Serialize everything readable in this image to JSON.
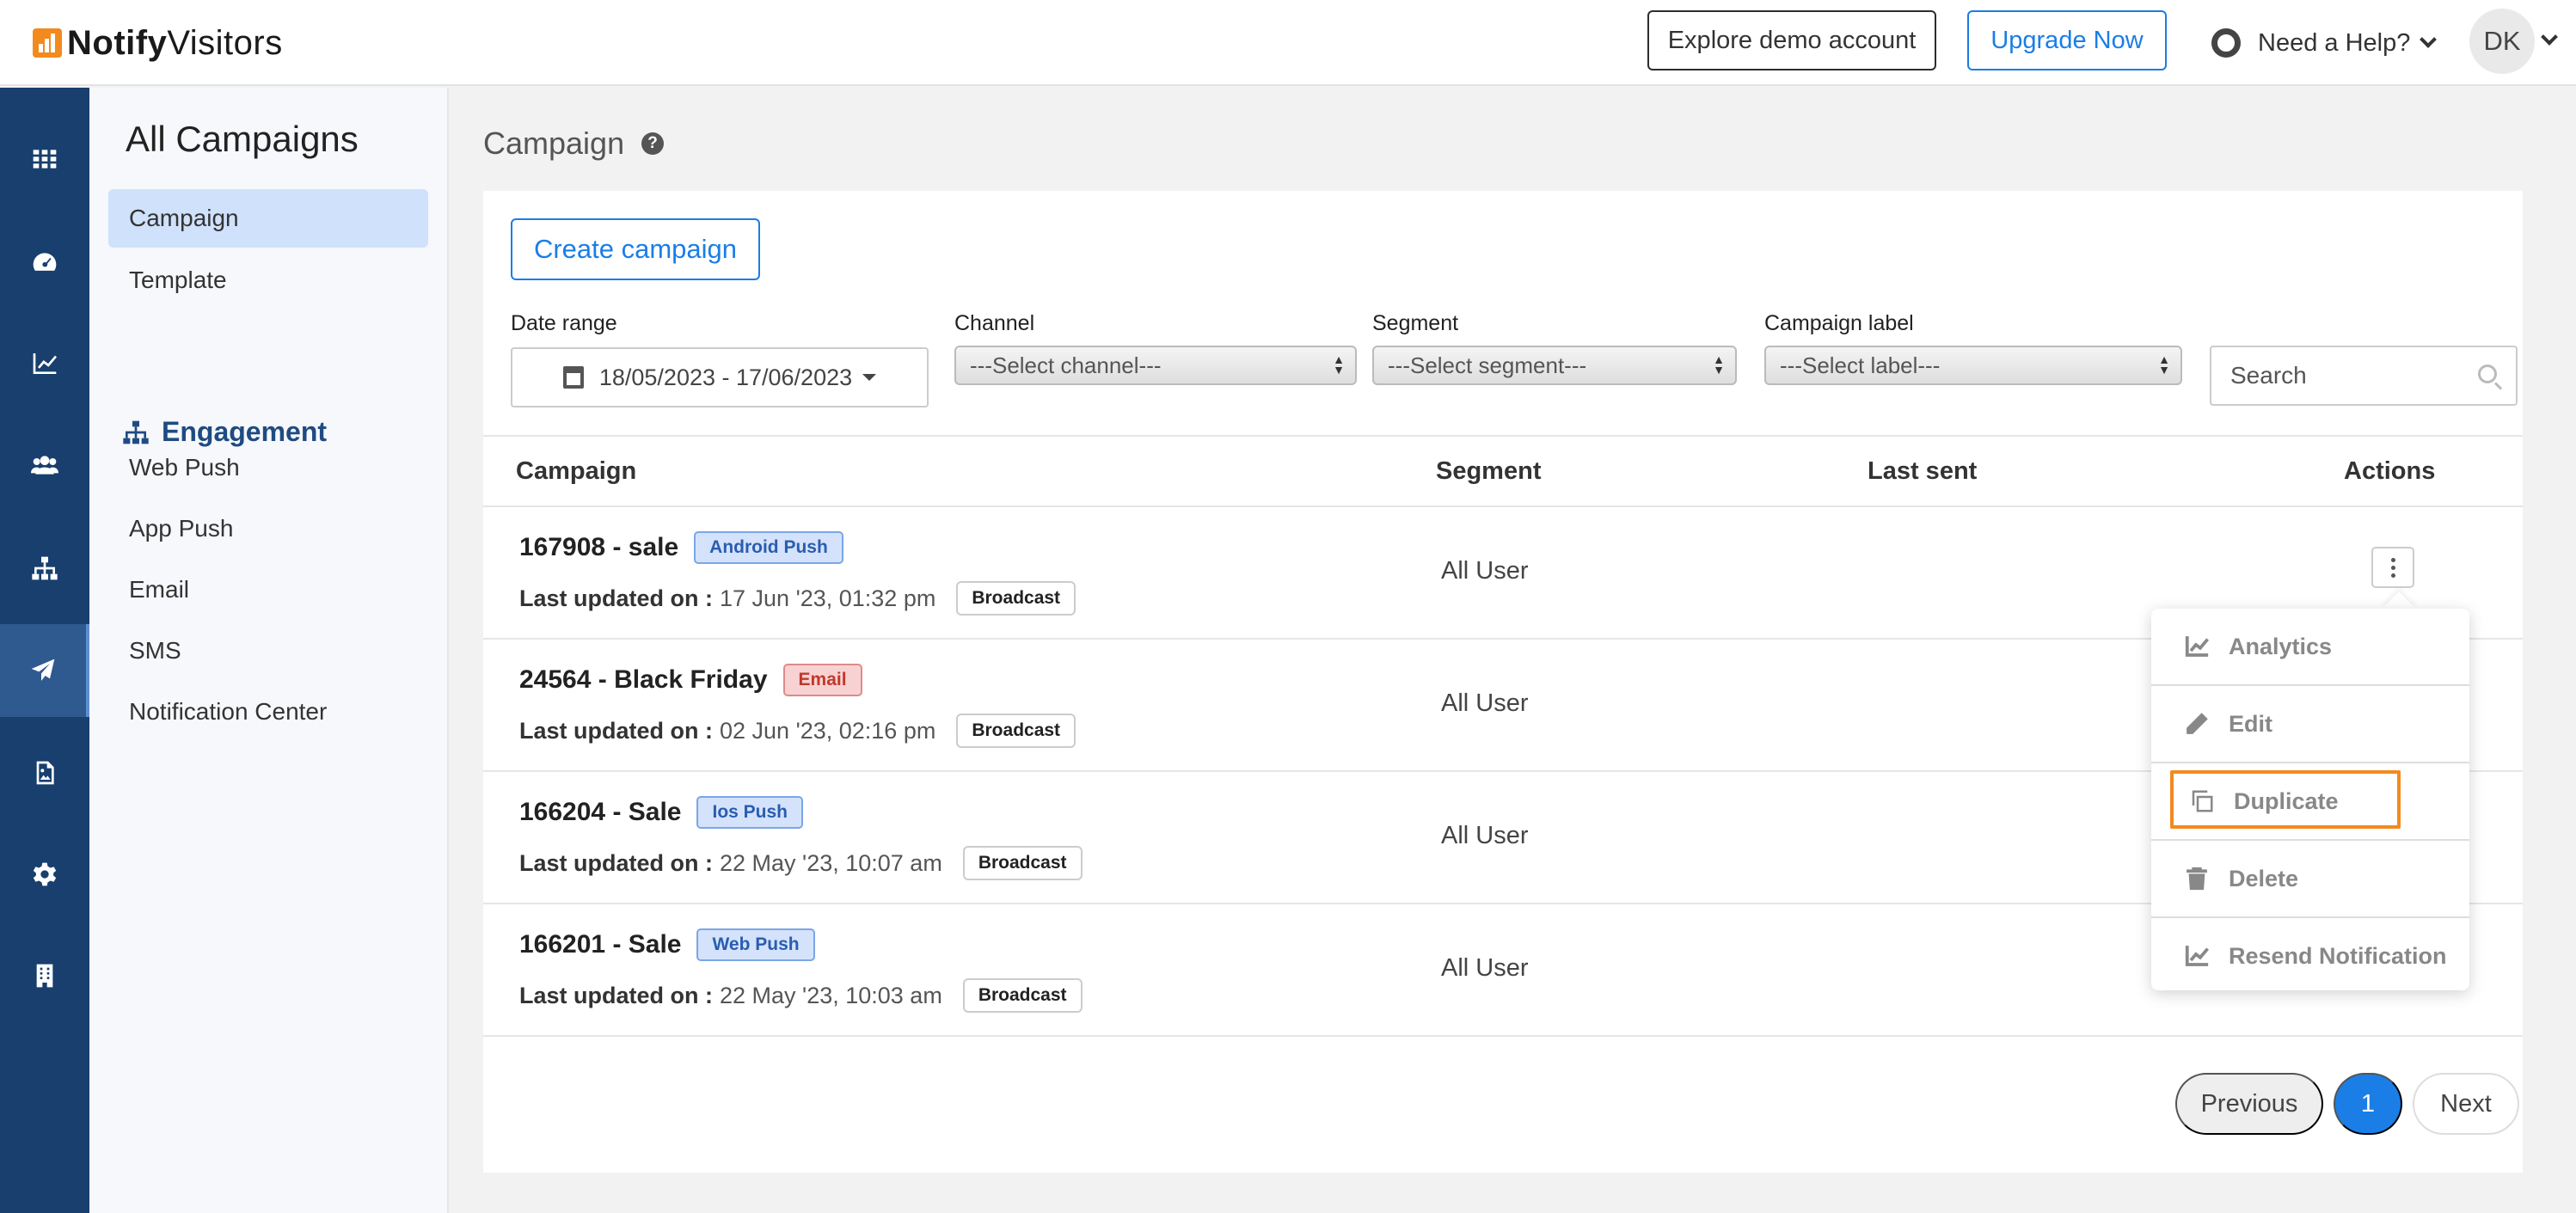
{
  "brand": {
    "name_bold": "Notify",
    "name_regular": "Visitors",
    "accent_color": "#f28a1e"
  },
  "topbar": {
    "demo_label": "Explore demo account",
    "upgrade_label": "Upgrade Now",
    "help_label": "Need a Help?",
    "avatar_initials": "DK"
  },
  "rail": {
    "icons": [
      "grid-icon",
      "dashboard-gauge-icon",
      "line-chart-icon",
      "users-icon",
      "hierarchy-icon",
      "paper-plane-icon",
      "image-file-icon",
      "gear-icon",
      "building-icon"
    ],
    "active": "paper-plane-icon"
  },
  "subnav": {
    "title": "All Campaigns",
    "items": [
      "Campaign",
      "Template"
    ],
    "section_label": "Engagement",
    "section_items": [
      "Web Push",
      "App Push",
      "Email",
      "SMS",
      "Notification Center"
    ]
  },
  "page": {
    "title": "Campaign",
    "help_icon": "?"
  },
  "toolbar": {
    "create_label": "Create campaign",
    "date_label": "Date range",
    "date_value": "18/05/2023 - 17/06/2023",
    "channel_label": "Channel",
    "channel_value": "---Select channel---",
    "segment_label": "Segment",
    "segment_value": "---Select segment---",
    "campaign_label_label": "Campaign label",
    "campaign_label_value": "---Select label---",
    "search_placeholder": "Search"
  },
  "table": {
    "headers": [
      "Campaign",
      "Segment",
      "Last sent",
      "Actions"
    ],
    "updated_prefix": "Last updated on :",
    "rows": [
      {
        "name": "167908 - sale",
        "tag": "Android Push",
        "tag_color": "blue",
        "updated": "17 Jun '23, 01:32 pm",
        "type": "Broadcast",
        "segment": "All User"
      },
      {
        "name": "24564 - Black Friday",
        "tag": "Email",
        "tag_color": "red",
        "updated": "02 Jun '23, 02:16 pm",
        "type": "Broadcast",
        "segment": "All User"
      },
      {
        "name": "166204 - Sale",
        "tag": "Ios Push",
        "tag_color": "blue",
        "updated": "22 May '23, 10:07 am",
        "type": "Broadcast",
        "segment": "All User"
      },
      {
        "name": "166201 - Sale",
        "tag": "Web Push",
        "tag_color": "blue",
        "updated": "22 May '23, 10:03 am",
        "type": "Broadcast",
        "segment": "All User"
      }
    ]
  },
  "actions_menu": {
    "items": [
      "Analytics",
      "Edit",
      "Duplicate",
      "Delete",
      "Resend Notification"
    ],
    "highlighted": "Duplicate",
    "highlight_color": "#f28a1e"
  },
  "pagination": {
    "prev_label": "Previous",
    "current_page": "1",
    "next_label": "Next"
  }
}
